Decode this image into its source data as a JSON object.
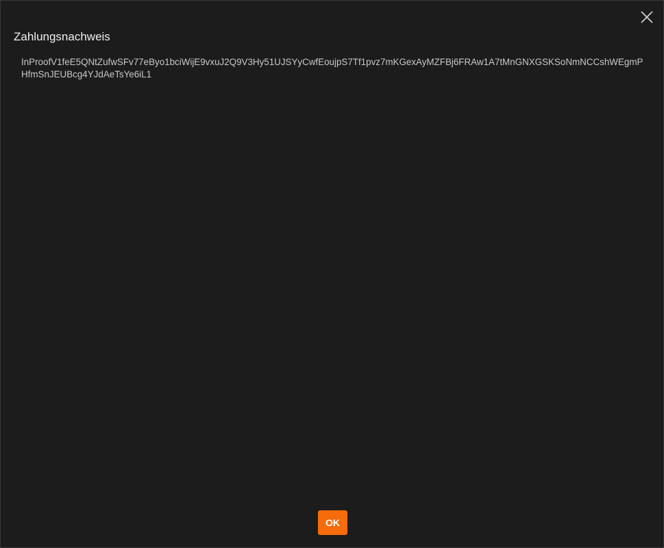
{
  "dialog": {
    "title": "Zahlungsnachweis",
    "proof_text": "InProofV1feE5QNtZufwSFv77eByo1bciWijE9vxuJ2Q9V3Hy51UJSYyCwfEoujpS7Tf1pvz7mKGexAyMZFBj6FRAw1A7tMnGNXGSKSoNmNCCshWEgmPHfmSnJEUBcg4YJdAeTsYe6iL1",
    "ok_label": "OK",
    "close_icon": "close-icon"
  },
  "colors": {
    "background": "#1c1c1c",
    "accent": "#f76b0a",
    "text": "#e8e8e8"
  }
}
